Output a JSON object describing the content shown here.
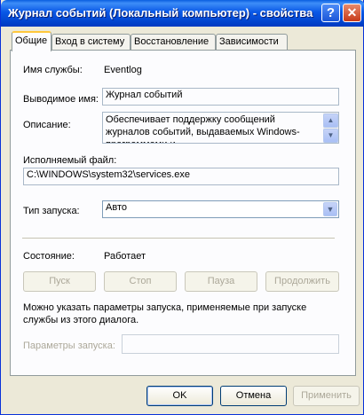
{
  "window": {
    "title": "Журнал событий (Локальный компьютер) - свойства",
    "help_label": "?",
    "close_label": "✕"
  },
  "tabs": [
    {
      "label": "Общие",
      "active": true
    },
    {
      "label": "Вход в систему",
      "active": false
    },
    {
      "label": "Восстановление",
      "active": false
    },
    {
      "label": "Зависимости",
      "active": false
    }
  ],
  "general": {
    "service_name_label": "Имя службы:",
    "service_name_value": "Eventlog",
    "display_name_label": "Выводимое имя:",
    "display_name_value": "Журнал событий",
    "description_label": "Описание:",
    "description_value": "Обеспечивает поддержку сообщений журналов событий, выдаваемых Windows-программами и",
    "executable_label": "Исполняемый файл:",
    "executable_value": "C:\\WINDOWS\\system32\\services.exe",
    "startup_type_label": "Тип запуска:",
    "startup_type_value": "Авто",
    "status_label": "Состояние:",
    "status_value": "Работает",
    "buttons": {
      "start": "Пуск",
      "stop": "Стоп",
      "pause": "Пауза",
      "resume": "Продолжить"
    },
    "params_hint": "Можно указать параметры запуска, применяемые при запуске службы из этого диалога.",
    "params_label": "Параметры запуска:",
    "params_value": ""
  },
  "footer": {
    "ok": "OK",
    "cancel": "Отмена",
    "apply": "Применить"
  },
  "icons": {
    "help": "help-icon",
    "close": "close-icon",
    "scroll_up": "scroll-up-icon",
    "scroll_down": "scroll-down-icon",
    "dropdown": "chevron-down-icon"
  }
}
